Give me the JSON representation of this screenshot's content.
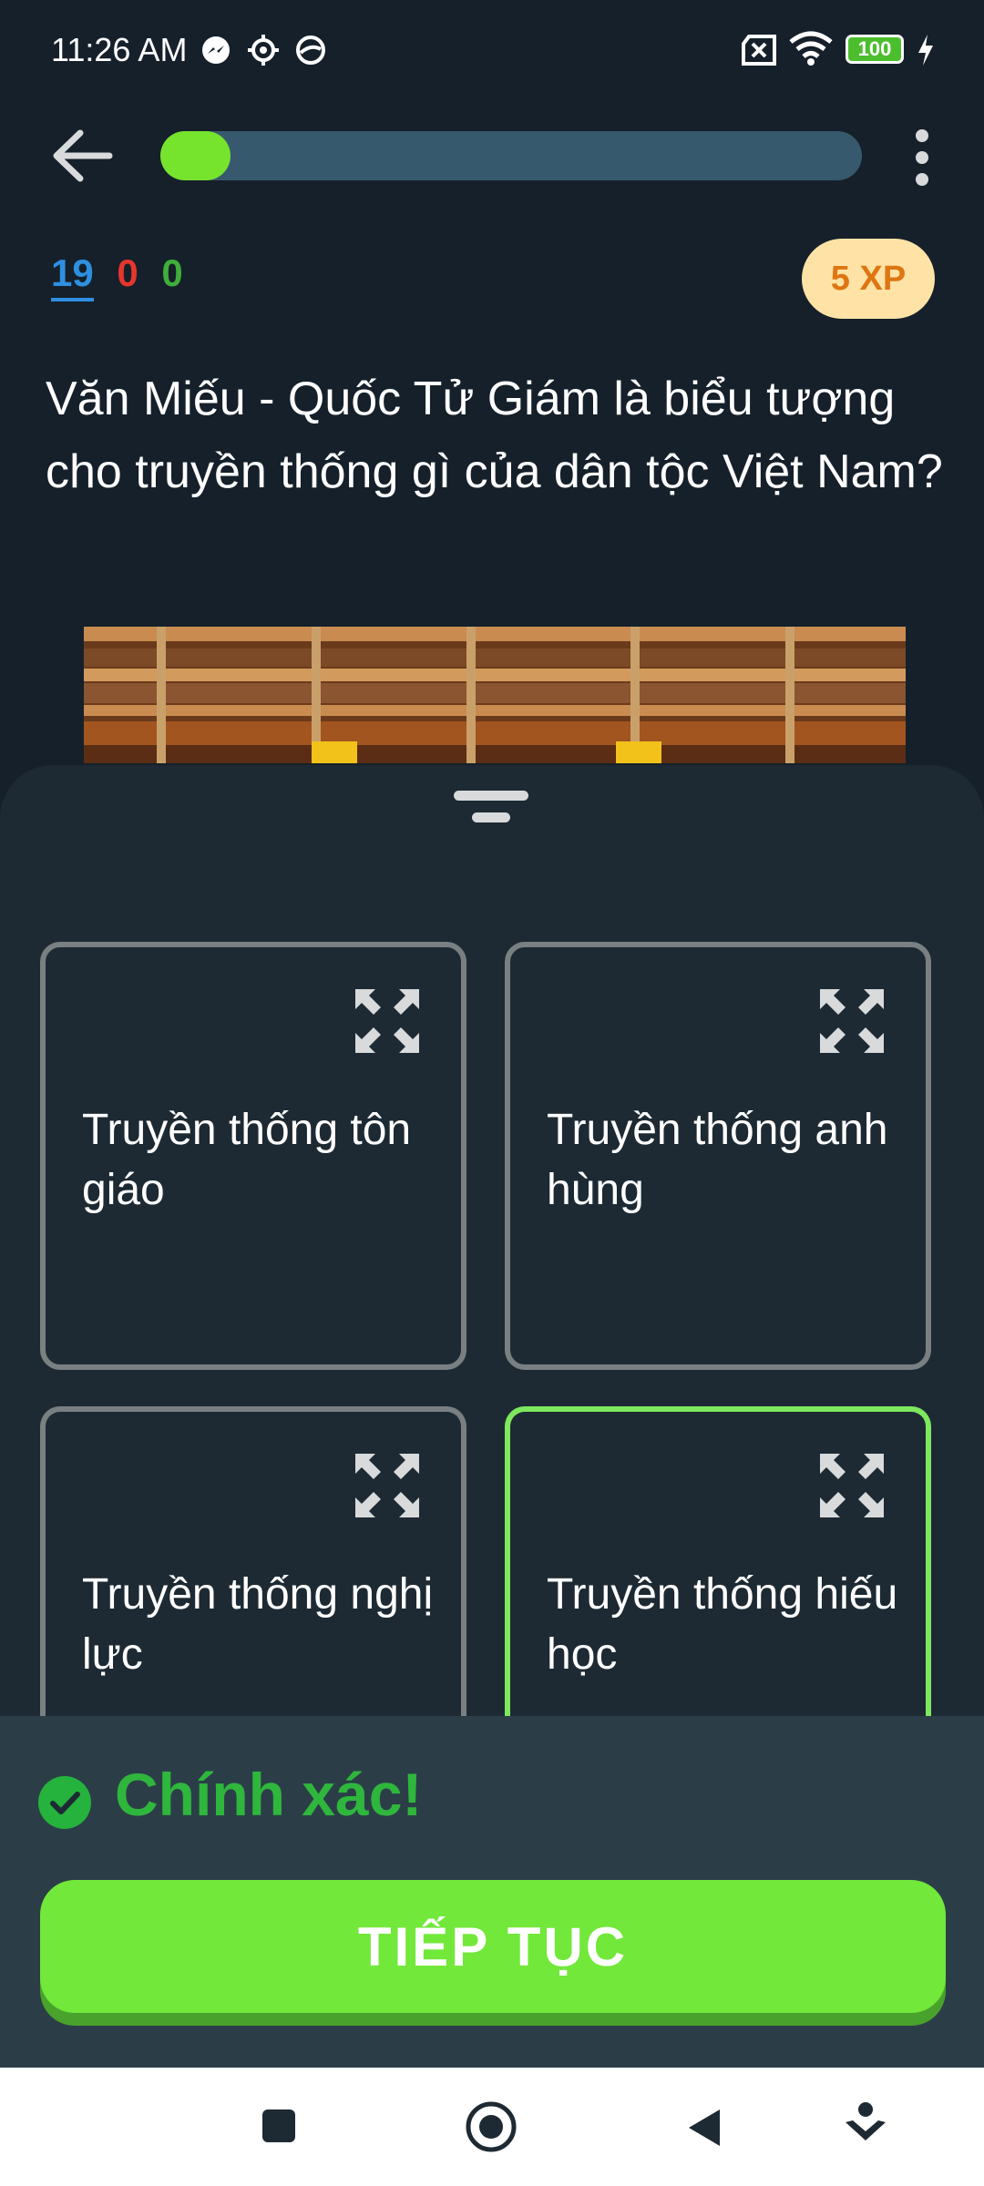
{
  "status_bar": {
    "time": "11:26 AM",
    "icons": [
      "messenger-icon",
      "settings-gear-icon",
      "helmet-icon",
      "no-sim-icon",
      "wifi-icon",
      "battery-icon",
      "charging-icon"
    ],
    "battery_level": "100"
  },
  "header": {
    "back_icon": "arrow-left-icon",
    "progress_fraction": 0.1,
    "menu_icon": "more-vertical-icon"
  },
  "stats": {
    "blue_value": "19",
    "red_value": "0",
    "green_value": "0",
    "xp_badge": "5 XP"
  },
  "question": {
    "text": "Văn Miếu - Quốc Tử Giám là biểu tượng cho truyền thống gì của dân tộc Việt Nam?"
  },
  "options": [
    {
      "label": "Truyền thống tôn giáo",
      "selected": false
    },
    {
      "label": "Truyền thống anh hùng",
      "selected": false
    },
    {
      "label": "Truyền thống nghị lực",
      "selected": false
    },
    {
      "label": "Truyền thống hiếu học",
      "selected": true
    }
  ],
  "feedback": {
    "message": "Chính xác!",
    "continue_label": "TIẾP TỤC"
  },
  "colors": {
    "background": "#15202a",
    "progress_fill": "#76e32d",
    "progress_track": "#37596e",
    "correct_green": "#2fb63c",
    "button_green": "#72e83a",
    "xp_badge_bg": "#ffe3a6",
    "xp_badge_text": "#dd7612"
  },
  "nav_bar": {
    "icons": [
      "recent-apps-square-icon",
      "home-circle-icon",
      "back-triangle-icon",
      "notification-down-icon"
    ]
  }
}
